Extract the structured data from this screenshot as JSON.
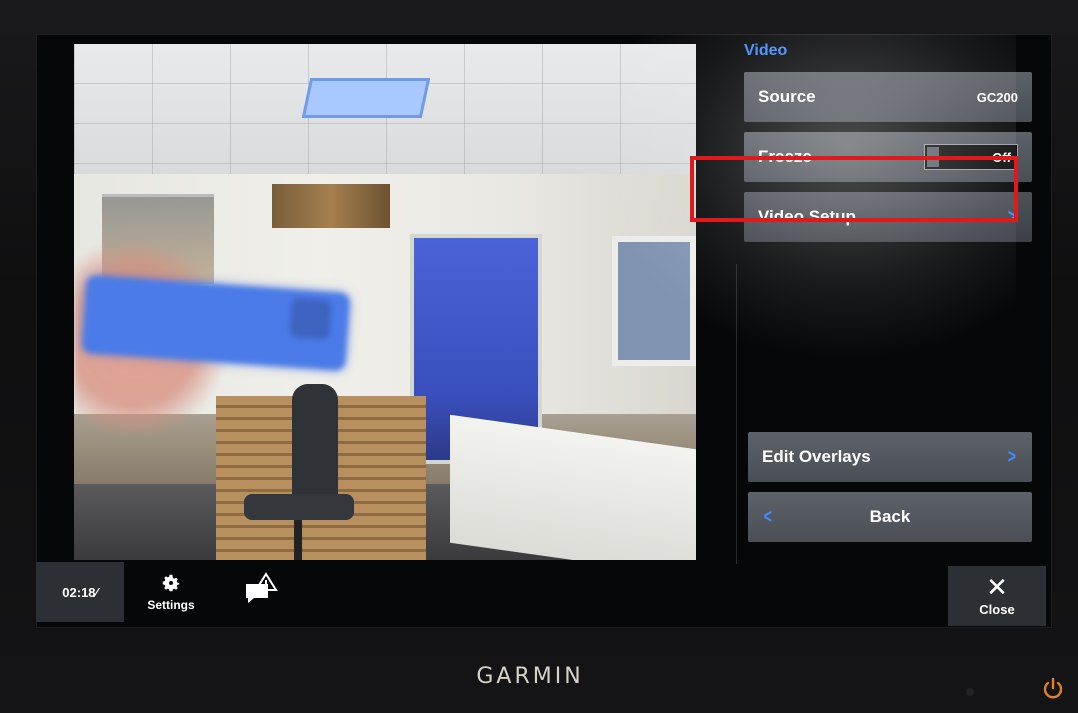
{
  "panel": {
    "title": "Video",
    "source_label": "Source",
    "source_value": "GC200",
    "freeze_label": "Freeze",
    "freeze_value": "Off",
    "video_setup_label": "Video Setup",
    "edit_overlays_label": "Edit Overlays",
    "back_label": "Back"
  },
  "bottom_bar": {
    "time": "02:18⁄",
    "settings_label": "Settings",
    "close_label": "Close"
  },
  "device": {
    "brand": "GARMIN"
  },
  "colors": {
    "accent_blue": "#3f8cff",
    "highlight_red": "#e0191d",
    "button_gray": "#4a4e55"
  },
  "icons": {
    "settings": "gear-icon",
    "notification": "message-alert-icon",
    "close": "close-icon",
    "chevron": "chevron-right-icon",
    "back": "chevron-left-icon",
    "power": "power-icon"
  }
}
